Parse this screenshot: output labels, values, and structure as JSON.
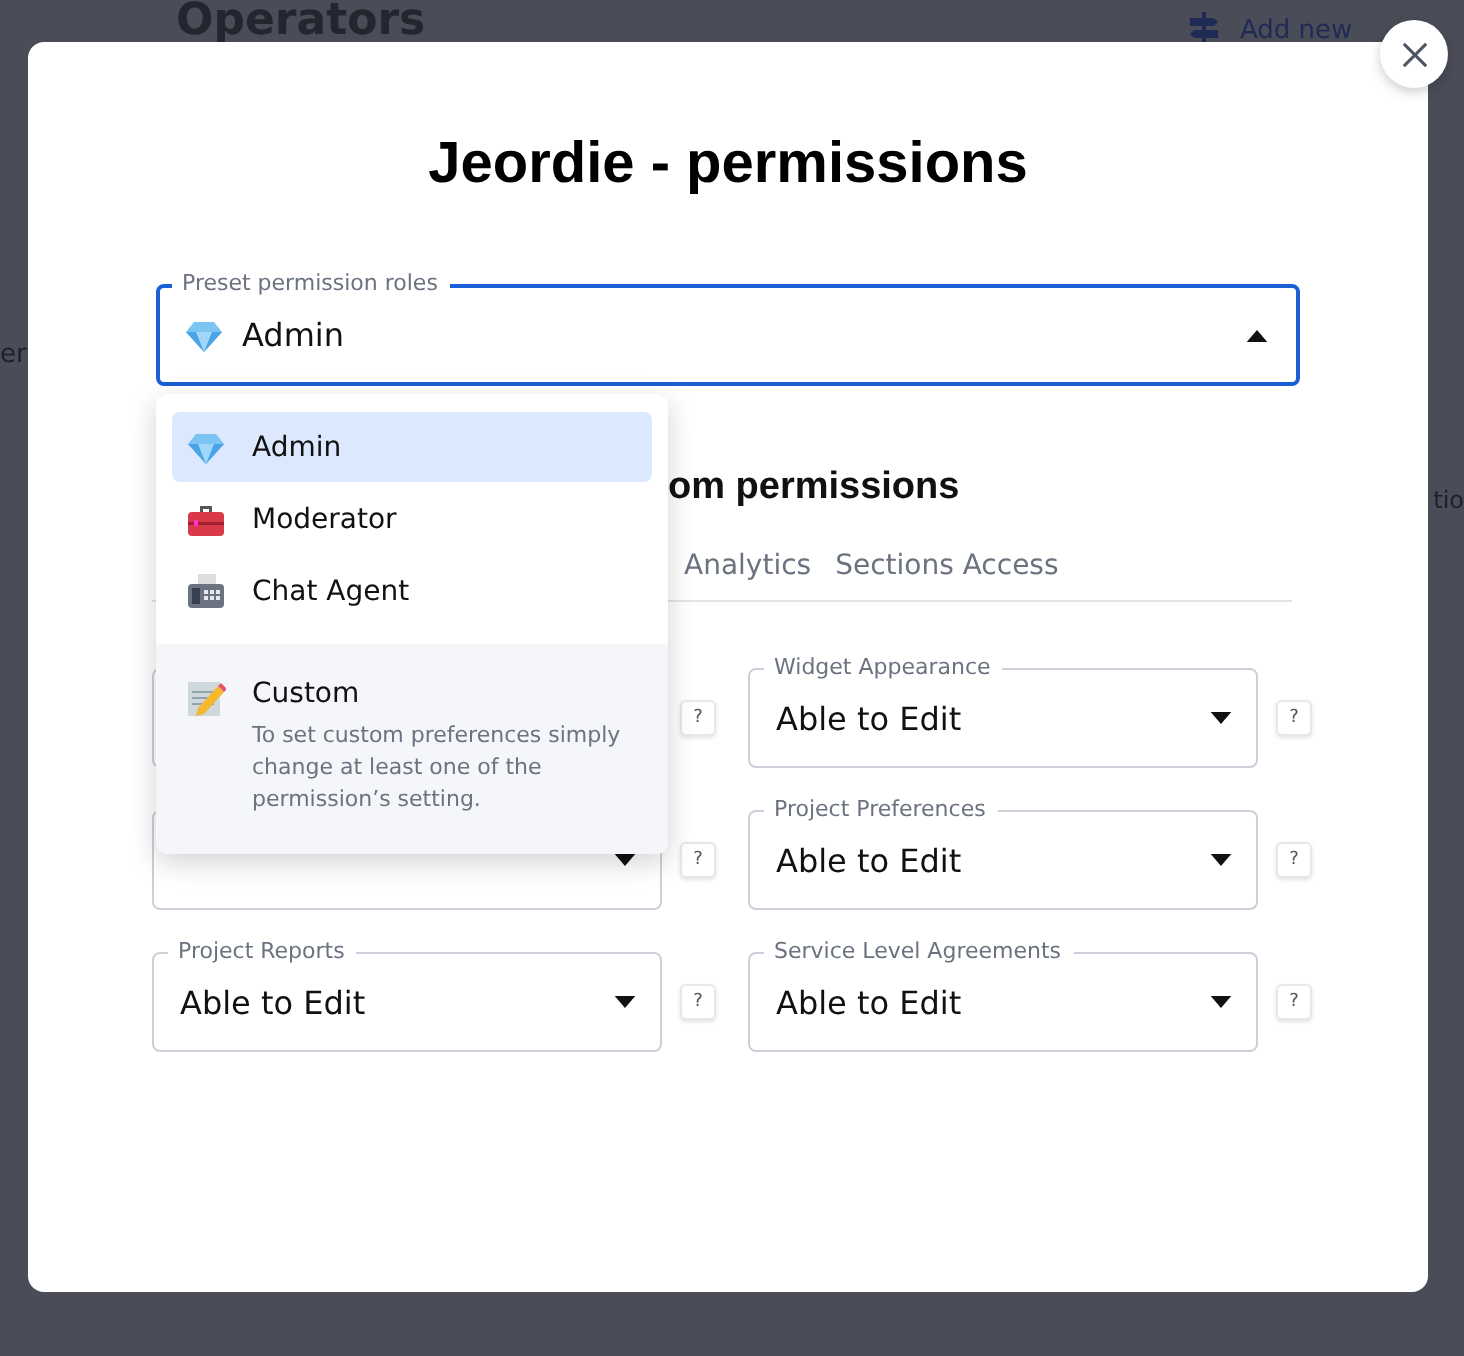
{
  "background": {
    "heading": "Operators",
    "action": "Add new",
    "left_fragment": "er",
    "right_fragment": "tio"
  },
  "dialog": {
    "title": "Jeordie - permissions",
    "role_select": {
      "label": "Preset permission roles",
      "value": "Admin",
      "expanded": true
    },
    "role_options": [
      {
        "kind": "role",
        "label": "Admin",
        "selected": true
      },
      {
        "kind": "role",
        "label": "Moderator",
        "selected": false
      },
      {
        "kind": "role",
        "label": "Chat Agent",
        "selected": false
      },
      {
        "kind": "custom",
        "label": "Custom",
        "description": "To set custom preferences simply change at least one of the permission’s setting.",
        "selected": false
      }
    ],
    "custom_heading": "om permissions",
    "tabs": [
      {
        "label": "Analytics",
        "selected": false
      },
      {
        "label": "Sections Access",
        "selected": false
      }
    ],
    "left_fields": [
      {
        "help": "?"
      },
      {
        "help": "?"
      },
      {
        "label": "Project Reports",
        "value": "Able to Edit",
        "help": "?"
      }
    ],
    "right_fields": [
      {
        "label": "Widget Appearance",
        "value": "Able to Edit",
        "help": "?"
      },
      {
        "label": "Project Preferences",
        "value": "Able to Edit",
        "help": "?"
      },
      {
        "label": "Service Level Agreements",
        "value": "Able to Edit",
        "help": "?"
      }
    ]
  }
}
